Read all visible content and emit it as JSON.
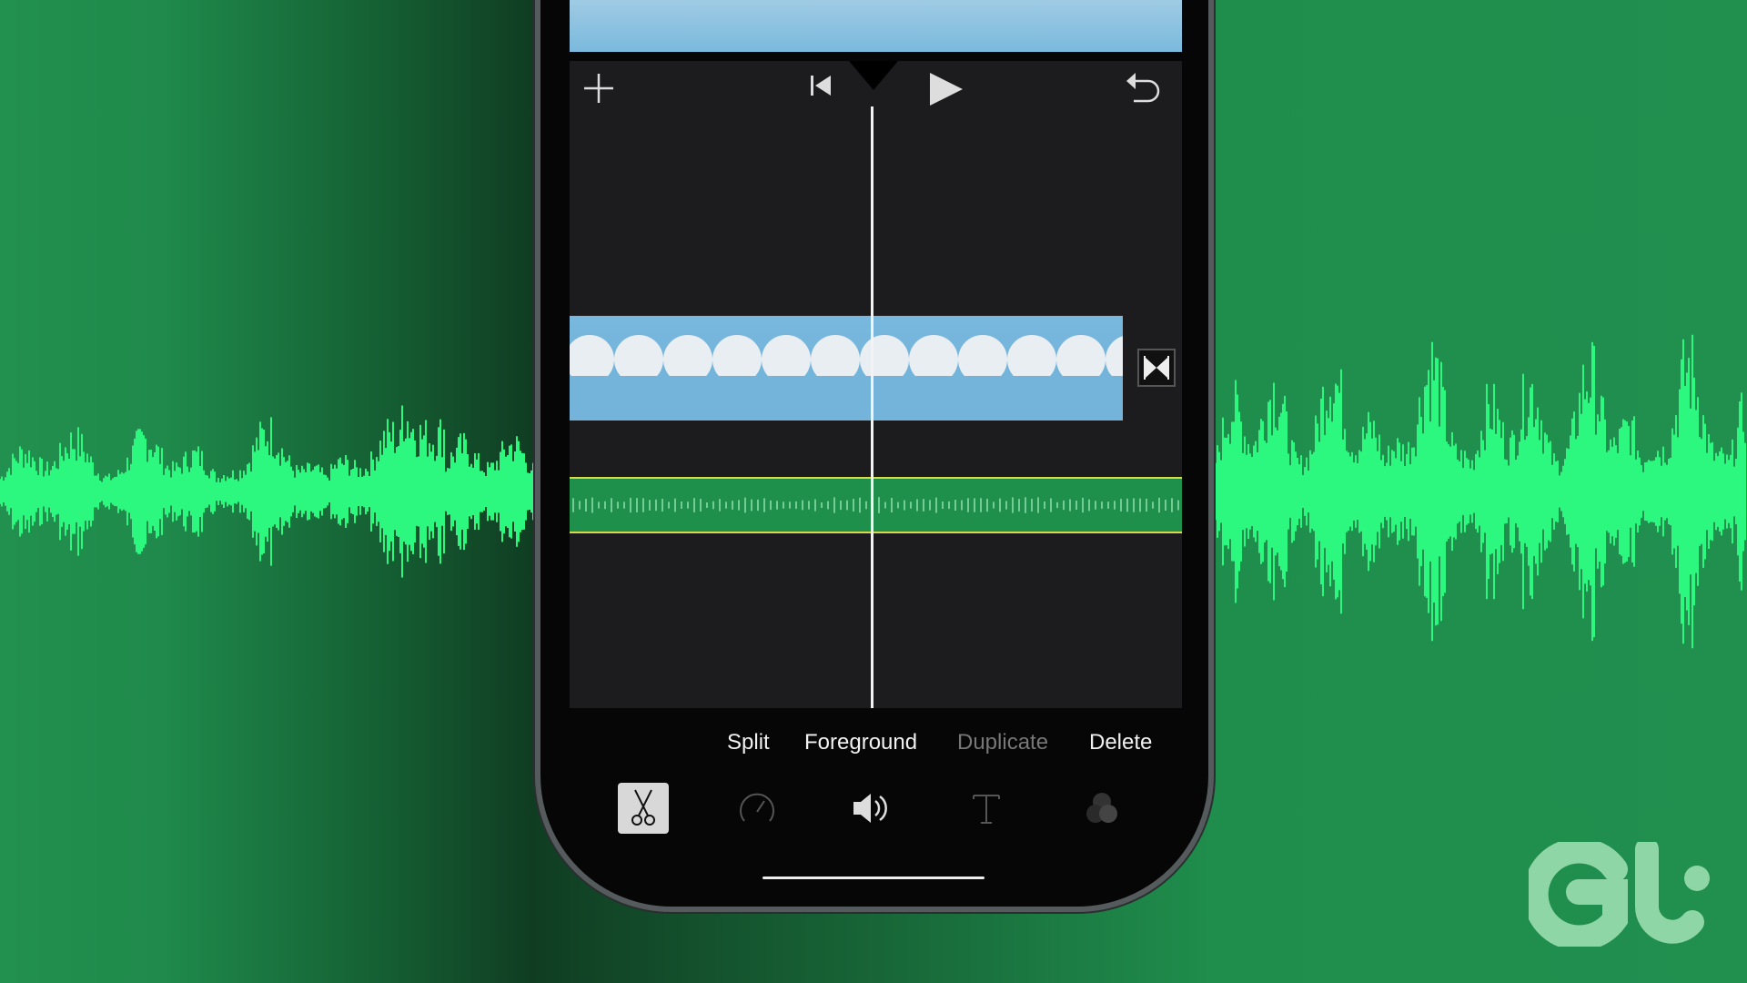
{
  "toolbar": {
    "add_icon": "plus-icon",
    "rewind_icon": "skip-to-start-icon",
    "play_icon": "play-icon",
    "undo_icon": "undo-icon"
  },
  "actions": [
    {
      "label": "Split",
      "enabled": true
    },
    {
      "label": "Foreground",
      "enabled": true
    },
    {
      "label": "Duplicate",
      "enabled": false
    },
    {
      "label": "Delete",
      "enabled": true
    }
  ],
  "tools": [
    {
      "icon": "scissors-icon",
      "selected": true
    },
    {
      "icon": "speedometer-icon",
      "selected": false
    },
    {
      "icon": "volume-icon",
      "selected": false
    },
    {
      "icon": "text-icon",
      "selected": false
    },
    {
      "icon": "filters-icon",
      "selected": false
    }
  ],
  "colors": {
    "background": "#1f8d4c",
    "waveform": "#2cf77f",
    "audio_track": "#1f8f4c",
    "audio_border": "#d6d94a",
    "timeline": "#1c1c1e"
  },
  "logo": "GT"
}
